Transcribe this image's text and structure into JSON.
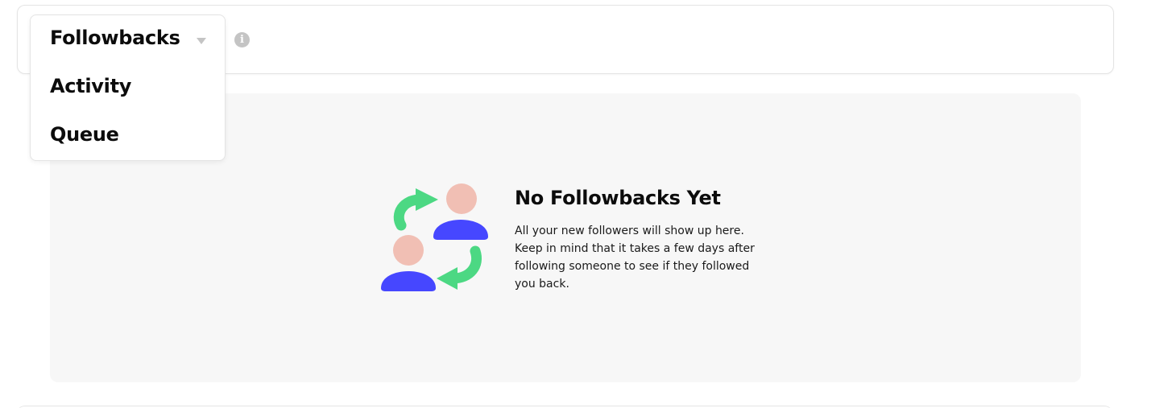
{
  "dropdown": {
    "selected": "Followbacks",
    "options": [
      "Activity",
      "Queue"
    ]
  },
  "empty_state": {
    "title": "No Followbacks Yet",
    "description": "All your new followers will show up here. Keep in mind that it takes a few days after following someone to see if they followed you back."
  },
  "icons": {
    "info": "info-icon",
    "caret": "chevron-down-icon",
    "illustration": "followback-exchange-illustration"
  },
  "colors": {
    "accent_green": "#4cd883",
    "avatar_blue": "#4647ff",
    "skin": "#f1bfb4",
    "panel_bg": "#f7f7f7"
  }
}
